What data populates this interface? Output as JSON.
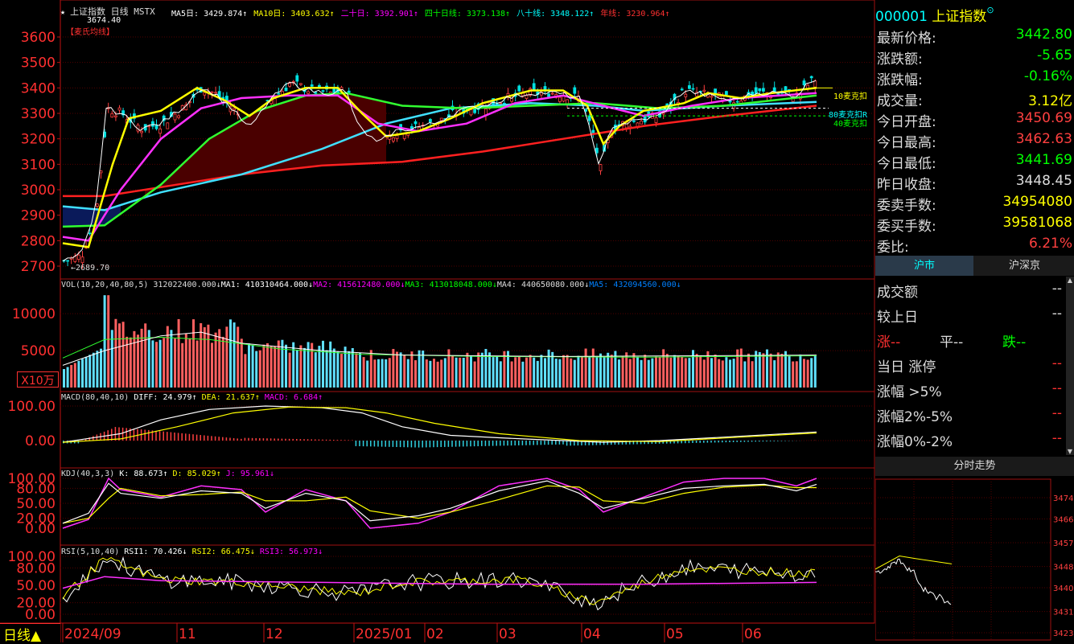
{
  "chart_title": {
    "star": "★",
    "label": "上证指数 日线 MSTX",
    "peak_marker": "3674.40",
    "indicator": "【麦氏均线】"
  },
  "ma_legend": [
    {
      "label": "MA5日: 3429.874↑",
      "color": "#ffffff"
    },
    {
      "label": "MA10日: 3403.632↑",
      "color": "#ffff00"
    },
    {
      "label": "二十日: 3392.901↑",
      "color": "#ff00ff"
    },
    {
      "label": "四十日线: 3373.138↑",
      "color": "#00ff00"
    },
    {
      "label": "八十线: 3348.122↑",
      "color": "#00ffff"
    },
    {
      "label": "年线: 3230.964↑",
      "color": "#ff3030"
    }
  ],
  "right_tags": {
    "t10": "10麦克扣",
    "t80": "80麦克扣R",
    "t40": "40麦克扣"
  },
  "price_axis": [
    "3600",
    "3500",
    "3400",
    "3300",
    "3200",
    "3100",
    "3000",
    "2900",
    "2800",
    "2700"
  ],
  "low_marker": "←2689.70",
  "vol": {
    "header": "VOL(10,20,40,80,5) 312022400.000↓",
    "ma1": "MA1: 410310464.000↓",
    "ma2": "MA2: 415612480.000↓",
    "ma3": "MA3: 413018048.000↓",
    "ma4": "MA4: 440650080.000↓",
    "ma5": "MA5: 432094560.000↓",
    "axis": [
      "10000",
      "5000"
    ],
    "unit": "X10万"
  },
  "macd": {
    "header": "MACD(80,40,10)",
    "diff": "DIFF: 24.979↑",
    "dea": "DEA: 21.637↑",
    "macd": "MACD: 6.684↑",
    "axis": [
      "100.00",
      "0.00"
    ]
  },
  "kdj": {
    "header": "KDJ(40,3,3)",
    "k": "K: 88.673↑",
    "d": "D: 85.029↑",
    "j": "J: 95.961↓",
    "axis": [
      "100.00",
      "80.00",
      "50.00",
      "20.00",
      "0.00"
    ]
  },
  "rsi": {
    "header": "RSI(5,10,40)",
    "rsi1": "RSI1: 70.426↓",
    "rsi2": "RSI2: 66.475↓",
    "rsi3": "RSI3: 56.973↓",
    "axis": [
      "100.00",
      "80.00",
      "50.00",
      "20.00",
      "0.00"
    ]
  },
  "period_label": "日线▲",
  "x_axis": [
    "2024/09",
    "11",
    "12",
    "2025/01",
    "02",
    "03",
    "04",
    "05",
    "06"
  ],
  "quote": {
    "code": "000001",
    "name": "上证指数",
    "rows": [
      {
        "label": "最新价格:",
        "value": "3442.80",
        "color": "#00ff00"
      },
      {
        "label": "涨跌额:",
        "value": "-5.65",
        "color": "#00ff00"
      },
      {
        "label": "涨跌幅:",
        "value": "-0.16%",
        "color": "#00ff00"
      },
      {
        "label": "成交量:",
        "value": "3.12亿",
        "color": "#ffff00"
      },
      {
        "label": "今日开盘:",
        "value": "3450.69",
        "color": "#ff4040"
      },
      {
        "label": "今日最高:",
        "value": "3462.63",
        "color": "#ff4040"
      },
      {
        "label": "今日最低:",
        "value": "3441.69",
        "color": "#00ff00"
      },
      {
        "label": "昨日收盘:",
        "value": "3448.45",
        "color": "#dddddd"
      },
      {
        "label": "委卖手数:",
        "value": "34954080",
        "color": "#ffff00"
      },
      {
        "label": "委买手数:",
        "value": "39581068",
        "color": "#ffff00"
      },
      {
        "label": "委比:",
        "value": "6.21%",
        "color": "#ff4040"
      }
    ]
  },
  "market_tabs": [
    "沪市",
    "沪深京"
  ],
  "stats": [
    {
      "label": "成交额",
      "value": "--"
    },
    {
      "label": "较上日",
      "value": "--"
    },
    {
      "label": "当日 涨停",
      "value": "--"
    },
    {
      "label": "涨幅 >5%",
      "value": "--"
    },
    {
      "label": "涨幅2%-5%",
      "value": "--"
    },
    {
      "label": "涨幅0%-2%",
      "value": "--"
    }
  ],
  "updown": {
    "up": "涨--",
    "flat": "平--",
    "down": "跌--"
  },
  "intraday": {
    "title": "分时走势",
    "axis": [
      "3474",
      "3466",
      "3457",
      "3448",
      "3440",
      "3431",
      "3423"
    ]
  }
}
